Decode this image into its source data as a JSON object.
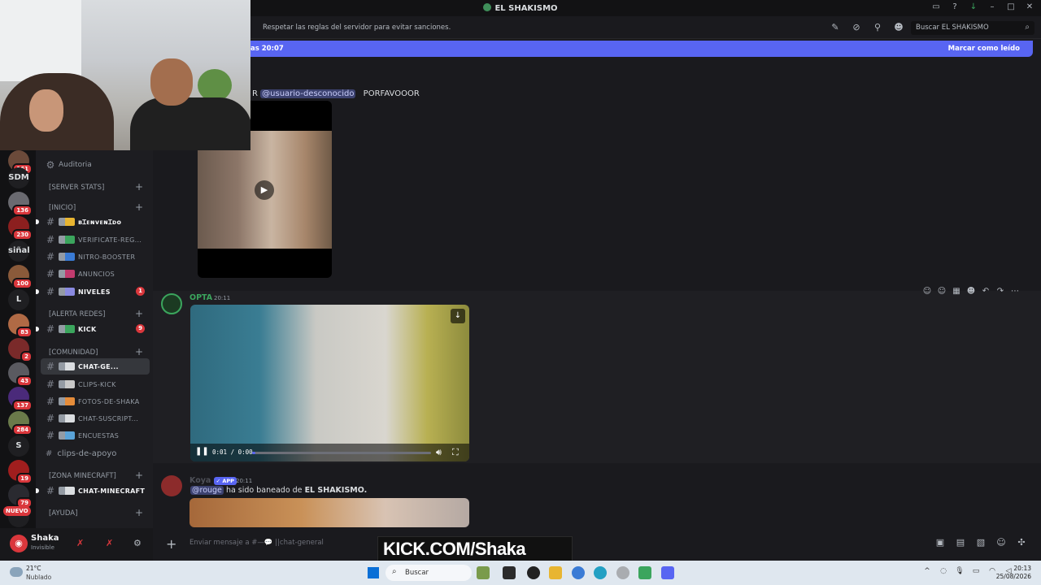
{
  "window": {
    "title": "EL SHAKISMO"
  },
  "topic": {
    "text": "Respetar las reglas del servidor para evitar sanciones."
  },
  "search": {
    "placeholder": "Buscar EL SHAKISMO"
  },
  "banner": {
    "left_text": "as 20:07",
    "right_text": "Marcar como leído"
  },
  "messages": {
    "first": {
      "prefix": "R",
      "mention": "@usuario-desconocido",
      "text": "PORFAVOOOR"
    },
    "second": {
      "author": "OPTA",
      "author_color": "#3ba55d",
      "time": "20:11",
      "video": {
        "time": "0:01 / 0:00",
        "progress": 0.02
      }
    },
    "third": {
      "author": "Koya",
      "tag": "✓ APP",
      "time": "20:11",
      "mention": "@rouge",
      "text": "ha sido baneado de",
      "server": "EL SHAKISMO."
    }
  },
  "composer": {
    "placeholder": "Enviar mensaje a #—💬 ||chat-general"
  },
  "servers": [
    {
      "label": "",
      "badge": "161"
    },
    {
      "label": "SDM",
      "badge": ""
    },
    {
      "label": "",
      "badge": "136"
    },
    {
      "label": "",
      "badge": "230"
    },
    {
      "label": "siñal",
      "badge": ""
    },
    {
      "label": "",
      "badge": "100"
    },
    {
      "label": "L",
      "badge": ""
    },
    {
      "label": "",
      "badge": "83"
    },
    {
      "label": "",
      "badge": "2"
    },
    {
      "label": "",
      "badge": "43"
    },
    {
      "label": "",
      "badge": "137"
    },
    {
      "label": "",
      "badge": "284"
    },
    {
      "label": "S",
      "badge": ""
    },
    {
      "label": "",
      "badge": "19"
    },
    {
      "label": "",
      "badge": "79"
    },
    {
      "label": "",
      "badge": "NUEVO"
    }
  ],
  "sidebar": {
    "auditoria": "Auditoria",
    "categories": {
      "server_stats": "[SERVER STATS]",
      "inicio": "[INICIO]",
      "alerta_redes": "[ALERTA REDES]",
      "comunidad": "[COMUNIDAD]",
      "zona_minecraft": "[Zona Minecraft]",
      "ayuda": "[AYUDA]"
    },
    "channels": [
      {
        "name": "ʙɪᴇɴᴠᴇɴɪᴅᴏ",
        "bold": true,
        "unread": ""
      },
      {
        "name": "verificate-reg...",
        "bold": false,
        "unread": ""
      },
      {
        "name": "nitro-booster",
        "bold": false,
        "unread": ""
      },
      {
        "name": "anuncios",
        "bold": false,
        "unread": ""
      },
      {
        "name": "niveles",
        "bold": true,
        "unread": "1"
      },
      {
        "name": "kick",
        "bold": true,
        "unread": "9"
      },
      {
        "name": "chat-ge...",
        "bold": true,
        "unread": ""
      },
      {
        "name": "clips-kick",
        "bold": false,
        "unread": ""
      },
      {
        "name": "fotos-de-shaka",
        "bold": false,
        "unread": ""
      },
      {
        "name": "chat-suscript...",
        "bold": false,
        "unread": ""
      },
      {
        "name": "encuestas",
        "bold": false,
        "unread": ""
      },
      {
        "name": "chat-minecraft",
        "bold": true,
        "unread": ""
      }
    ],
    "clips": "clips-de-apoyo"
  },
  "user": {
    "name": "Shaka",
    "status": "Invisible"
  },
  "watermark": {
    "text": "KICK.COM/Shaka"
  },
  "taskbar": {
    "temp": "21°C",
    "condition": "Nublado",
    "search": "Buscar",
    "time": "20:13",
    "date": "25/08/2026"
  }
}
